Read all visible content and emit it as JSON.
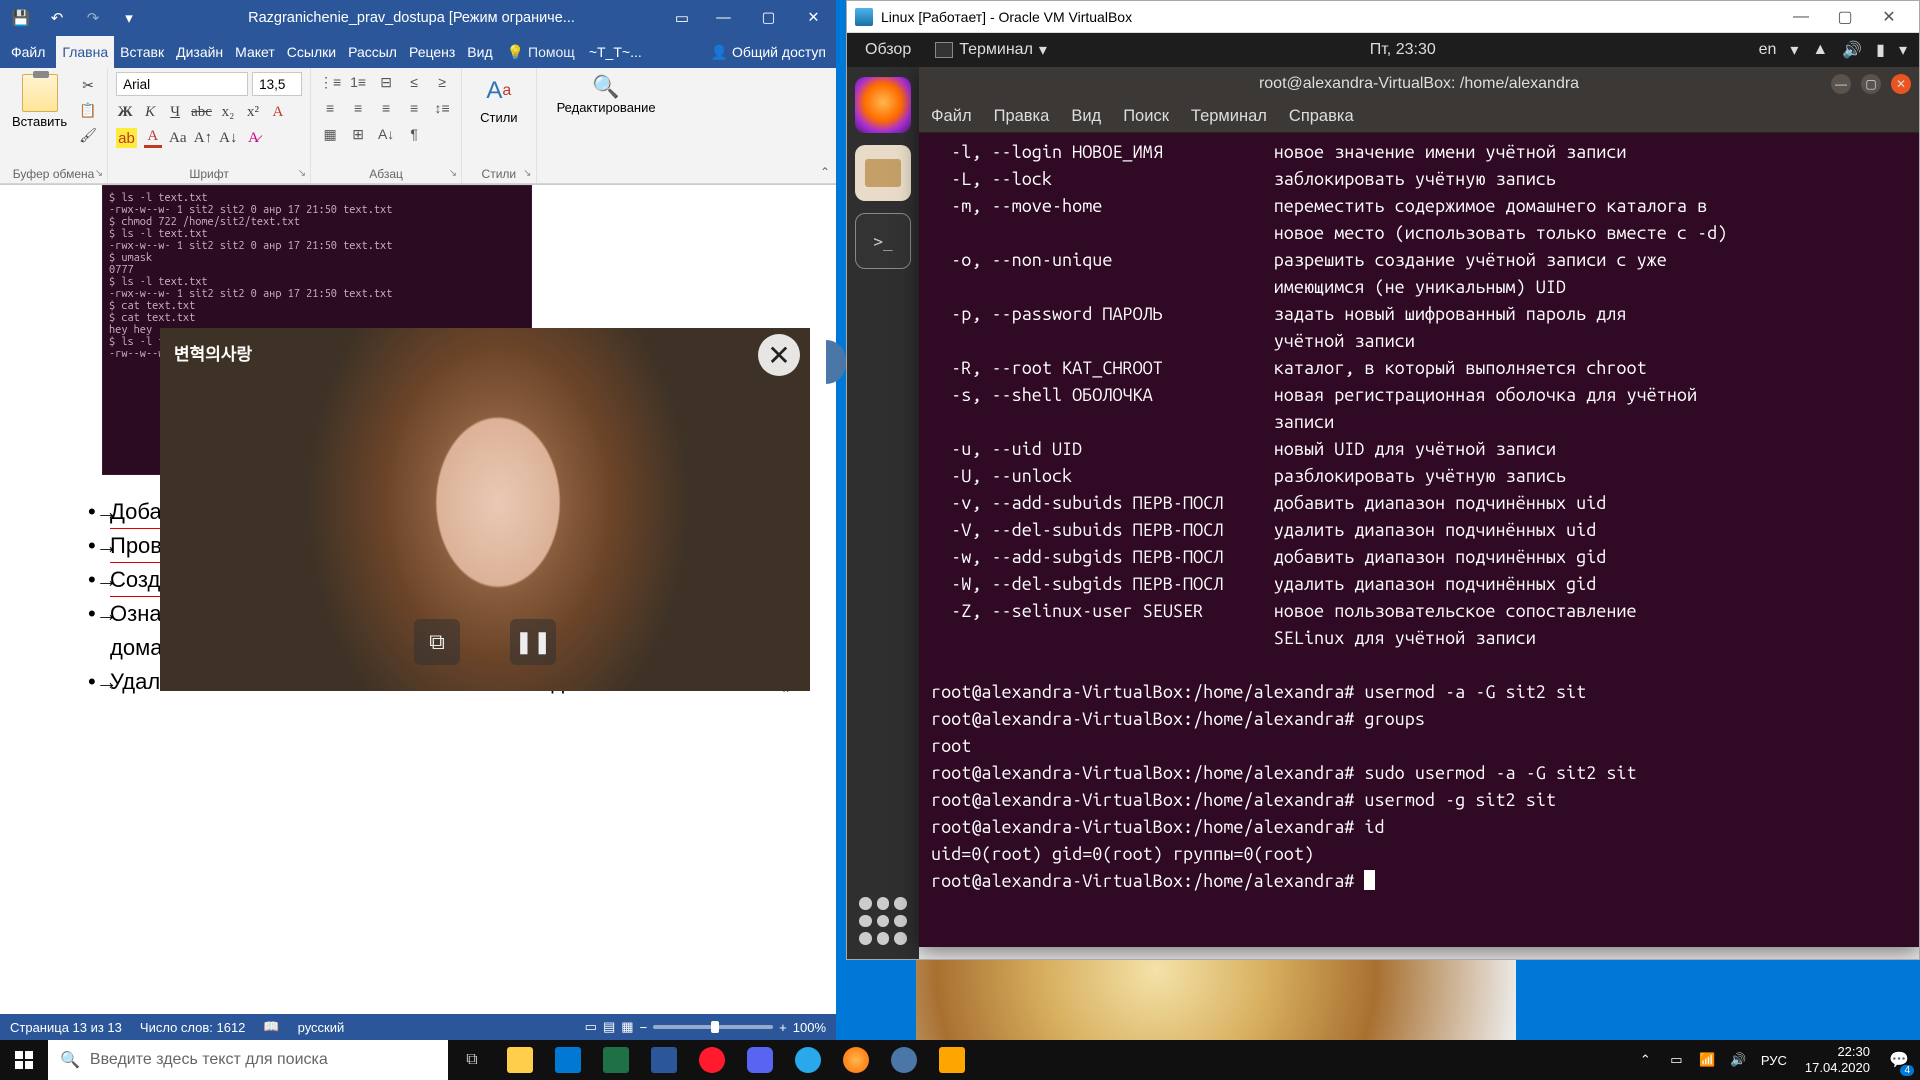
{
  "word": {
    "titlebar": "Razgranichenie_prav_dostupa [Режим ограниче...",
    "tabs": {
      "file": "Файл",
      "home": "Главна",
      "insert": "Вставк",
      "design": "Дизайн",
      "layout": "Макет",
      "refs": "Ссылки",
      "mail": "Рассыл",
      "review": "Реценз",
      "view": "Вид",
      "tell": "Помощ",
      "user": "~T_T~...",
      "share": "Общий доступ"
    },
    "ribbon": {
      "clipboard": {
        "paste": "Вставить",
        "label": "Буфер обмена"
      },
      "font": {
        "name": "Arial",
        "size": "13,5",
        "label": "Шрифт"
      },
      "paragraph": {
        "label": "Абзац"
      },
      "styles": {
        "btn": "Стили",
        "label": "Стили"
      },
      "editing": {
        "btn": "Редактирование"
      }
    },
    "embedded_terminal": "$ ls -l text.txt\n-rwx-w--w- 1 sit2 sit2 0 анр 17 21:50 text.txt\n$ chmod 722 /home/sit2/text.txt\n$ ls -l text.txt\n-rwx-w--w- 1 sit2 sit2 0 анр 17 21:50 text.txt\n$ umask\n0777\n$ ls -l text.txt\n-rwx-w--w- 1 sit2 sit2 0 анр 17 21:50 text.txt\n$ cat text.txt\n$ cat text.txt\nhey hey\n$ ls -l text.txt\n-rw--w--w- 1 sit2 sit2 8 анр 17 22:24 text.txt",
    "list": [
      "Добави\nuserm",
      "Прове",
      "Созда\nпольз",
      "Ознакомьтесь·как·удалить·пользователя·вместе·с·содержимым·его домашнего·каталога·из·справочной·документации¶",
      "Удалите·пользователя·«sit2»·вместе·с·его·домашним·каталогом.¶"
    ],
    "status": {
      "page": "Страница 13 из 13",
      "words": "Число слов: 1612",
      "lang": "русский",
      "zoom": "100%"
    }
  },
  "video": {
    "logo": "변혁의사랑"
  },
  "vbox": {
    "title": "Linux [Работает] - Oracle VM VirtualBox",
    "ubuntu_topbar": {
      "activities": "Обзор",
      "terminal": "Терминал",
      "clock": "Пт, 23:30",
      "lang": "en"
    },
    "terminal": {
      "title": "root@alexandra-VirtualBox: /home/alexandra",
      "menus": [
        "Файл",
        "Правка",
        "Вид",
        "Поиск",
        "Терминал",
        "Справка"
      ],
      "help_lines": [
        {
          "o": "-l, --login НОВОЕ_ИМЯ",
          "d": "новое значение имени учётной записи"
        },
        {
          "o": "-L, --lock",
          "d": "заблокировать учётную запись"
        },
        {
          "o": "-m, --move-home",
          "d": "переместить содержимое домашнего каталога в"
        },
        {
          "o": "",
          "d": "новое место (использовать только вместе с -d)"
        },
        {
          "o": "-o, --non-unique",
          "d": "разрешить создание учётной записи с уже"
        },
        {
          "o": "",
          "d": "имеющимся (не уникальным) UID"
        },
        {
          "o": "-p, --password ПАРОЛЬ",
          "d": "задать новый шифрованный пароль для"
        },
        {
          "o": "",
          "d": "учётной записи"
        },
        {
          "o": "-R, --root КАТ_CHROOT",
          "d": "каталог, в который выполняется chroot"
        },
        {
          "o": "-s, --shell ОБОЛОЧКА",
          "d": "новая регистрационная оболочка для учётной"
        },
        {
          "o": "",
          "d": "записи"
        },
        {
          "o": "-u, --uid UID",
          "d": "новый UID для учётной записи"
        },
        {
          "o": "-U, --unlock",
          "d": "разблокировать учётную запись"
        },
        {
          "o": "-v, --add-subuids ПЕРВ-ПОСЛ",
          "d": "добавить диапазон подчинённых uid"
        },
        {
          "o": "-V, --del-subuids ПЕРВ-ПОСЛ",
          "d": "удалить диапазон подчинённых uid"
        },
        {
          "o": "-w, --add-subgids ПЕРВ-ПОСЛ",
          "d": "добавить диапазон подчинённых gid"
        },
        {
          "o": "-W, --del-subgids ПЕРВ-ПОСЛ",
          "d": "удалить диапазон подчинённых gid"
        },
        {
          "o": "-Z, --selinux-user SEUSER",
          "d": "новое пользовательское сопоставление"
        },
        {
          "o": "",
          "d": "SELinux для учётной записи"
        }
      ],
      "session": [
        "root@alexandra-VirtualBox:/home/alexandra# usermod -a -G sit2 sit",
        "root@alexandra-VirtualBox:/home/alexandra# groups",
        "root",
        "root@alexandra-VirtualBox:/home/alexandra# sudo usermod -a -G sit2 sit",
        "root@alexandra-VirtualBox:/home/alexandra# usermod -g sit2 sit",
        "root@alexandra-VirtualBox:/home/alexandra# id",
        "uid=0(root) gid=0(root) группы=0(root)",
        "root@alexandra-VirtualBox:/home/alexandra# "
      ]
    }
  },
  "taskbar": {
    "search_placeholder": "Введите здесь текст для поиска",
    "lang": "РУС",
    "time": "22:30",
    "date": "17.04.2020",
    "notif": "4"
  }
}
